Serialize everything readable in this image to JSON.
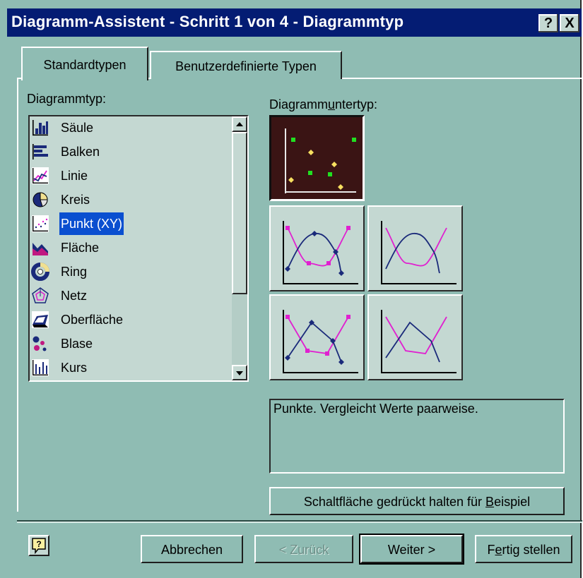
{
  "window": {
    "title": "Diagramm-Assistent - Schritt 1 von 4 - Diagrammtyp",
    "help_glyph": "?",
    "close_glyph": "X"
  },
  "tabs": [
    {
      "label": "Standardtypen",
      "active": true
    },
    {
      "label": "Benutzerdefinierte Typen",
      "active": false
    }
  ],
  "chart_type_list": {
    "label_pre": "Dia",
    "label_u": "g",
    "label_post": "rammtyp:",
    "items": [
      {
        "label": "Säule",
        "icon": "column-chart-icon"
      },
      {
        "label": "Balken",
        "icon": "bar-chart-icon"
      },
      {
        "label": "Linie",
        "icon": "line-chart-icon"
      },
      {
        "label": "Kreis",
        "icon": "pie-chart-icon"
      },
      {
        "label": "Punkt (XY)",
        "icon": "scatter-chart-icon",
        "selected": true
      },
      {
        "label": "Fläche",
        "icon": "area-chart-icon"
      },
      {
        "label": "Ring",
        "icon": "doughnut-chart-icon"
      },
      {
        "label": "Netz",
        "icon": "radar-chart-icon"
      },
      {
        "label": "Oberfläche",
        "icon": "surface-chart-icon"
      },
      {
        "label": "Blase",
        "icon": "bubble-chart-icon"
      },
      {
        "label": "Kurs",
        "icon": "stock-chart-icon"
      }
    ]
  },
  "subtypes": {
    "label_pre": "Diagramm",
    "label_u": "u",
    "label_post": "ntertyp:",
    "selected_index": 0
  },
  "description": "Punkte. Vergleicht Werte paarweise.",
  "preview_button": {
    "label_pre": "Schaltfläche gedrückt halten für ",
    "label_u": "B",
    "label_post": "eispiel"
  },
  "buttons": {
    "cancel": "Abbrechen",
    "back": "< Zurück",
    "next": "Weiter >",
    "finish_pre": "F",
    "finish_u": "e",
    "finish_post": "rtig stellen"
  },
  "colors": {
    "dialog_bg": "#8fbcb3",
    "titlebar_bg": "#041c73",
    "selection": "#0a4fd0",
    "series_magenta": "#e020d0",
    "series_navy": "#1a2a7a"
  }
}
